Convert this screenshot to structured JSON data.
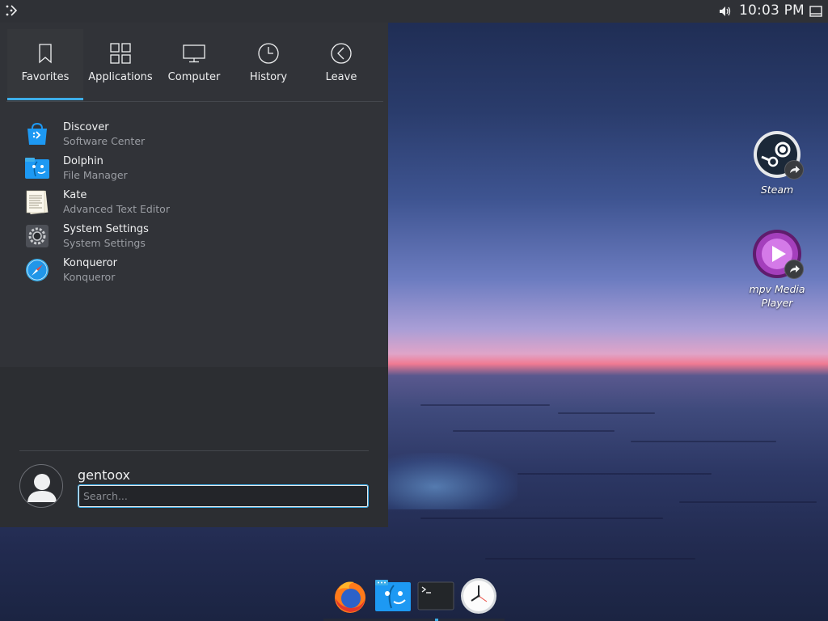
{
  "panel": {
    "clock": "10:03 PM"
  },
  "launcher": {
    "tabs": [
      {
        "label": "Favorites",
        "icon": "bookmark-icon",
        "active": true
      },
      {
        "label": "Applications",
        "icon": "grid-icon",
        "active": false
      },
      {
        "label": "Computer",
        "icon": "monitor-icon",
        "active": false
      },
      {
        "label": "History",
        "icon": "clock-icon",
        "active": false
      },
      {
        "label": "Leave",
        "icon": "back-arrow-icon",
        "active": false
      }
    ],
    "favorites": [
      {
        "name": "Discover",
        "description": "Software Center",
        "icon": "discover-icon"
      },
      {
        "name": "Dolphin",
        "description": "File Manager",
        "icon": "dolphin-icon"
      },
      {
        "name": "Kate",
        "description": "Advanced Text Editor",
        "icon": "kate-icon"
      },
      {
        "name": "System Settings",
        "description": "System Settings",
        "icon": "settings-icon"
      },
      {
        "name": "Konqueror",
        "description": "Konqueror",
        "icon": "konqueror-icon"
      }
    ],
    "user": {
      "name": "gentoox"
    },
    "search": {
      "placeholder": "Search...",
      "value": ""
    }
  },
  "desktop": {
    "icons": [
      {
        "label": "Steam",
        "icon": "steam-icon"
      },
      {
        "label": "mpv Media Player",
        "icon": "mpv-icon"
      }
    ]
  },
  "dock": {
    "items": [
      {
        "icon": "firefox-icon"
      },
      {
        "icon": "dolphin-icon"
      },
      {
        "icon": "terminal-icon"
      },
      {
        "icon": "clock-app-icon"
      }
    ]
  },
  "colors": {
    "accent": "#3daee9",
    "panel": "#2f3136",
    "launcher_bg": "#313338",
    "text": "#eff0f1",
    "subtext": "#9a9da3"
  }
}
